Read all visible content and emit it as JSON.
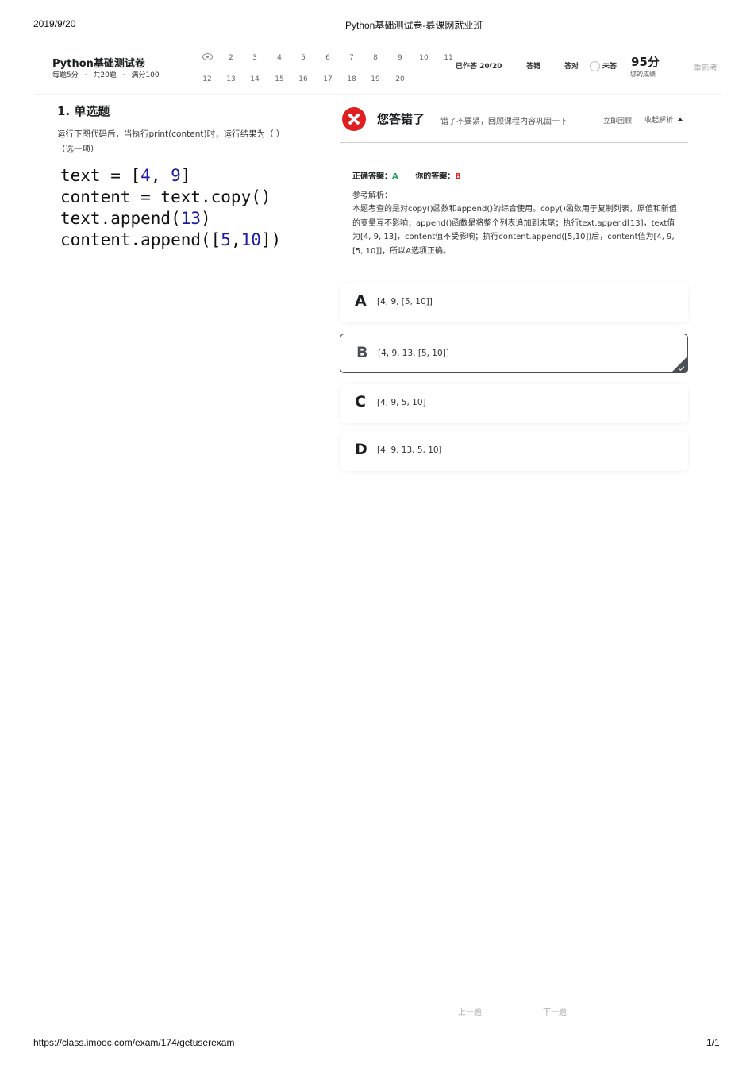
{
  "print_header": {
    "date": "2019/9/20",
    "title": "Python基础测试卷-慕课网就业班"
  },
  "print_footer": {
    "url": "https://class.imooc.com/exam/174/getuserexam",
    "page": "1/1"
  },
  "exam": {
    "title": "Python基础测试卷",
    "meta": [
      "每题5分",
      "共20题",
      "满分100"
    ],
    "meta_sep": "·"
  },
  "question_nav": {
    "row1": [
      "2",
      "3",
      "4",
      "5",
      "6",
      "7",
      "8",
      "9",
      "10",
      "11"
    ],
    "row2": [
      "12",
      "13",
      "14",
      "15",
      "16",
      "17",
      "18",
      "19",
      "20"
    ]
  },
  "stats": {
    "answered": "已作答 20/20",
    "wrong": "答错",
    "correct": "答对",
    "unanswered": "未答",
    "score": "95分",
    "score_label": "您的成绩",
    "retake": "重新考"
  },
  "question": {
    "heading": "1. 单选题",
    "text": "运行下图代码后，当执行print(content)时，运行结果为（ ）（选一项）",
    "code": [
      [
        "text = [",
        "4",
        ", ",
        "9",
        "]"
      ],
      [
        "content = text.copy()"
      ],
      [
        "text.append(",
        "13",
        ")"
      ],
      [
        "content.append([",
        "5",
        ",",
        "10",
        "])"
      ]
    ]
  },
  "result": {
    "title": "您答错了",
    "subtitle": "错了不要紧，回顾课程内容巩固一下",
    "review": "立即回顾",
    "collapse": "收起解析",
    "correct_label": "正确答案：",
    "correct_value": "A",
    "yours_label": "你的答案：",
    "yours_value": "B",
    "analysis_label": "参考解析：",
    "analysis": "本题考查的是对copy()函数和append()的综合使用。copy()函数用于复制列表，原值和新值的变量互不影响；append()函数是将整个列表追加到末尾；执行text.append[13]，text值为[4, 9, 13]，content值不受影响；执行content.append([5,10])后，content值为[4, 9, [5, 10]]，所以A选项正确。"
  },
  "options": [
    {
      "letter": "A",
      "text": "[4, 9, [5, 10]]"
    },
    {
      "letter": "B",
      "text": "[4, 9, 13, [5, 10]]"
    },
    {
      "letter": "C",
      "text": "[4, 9, 5, 10]"
    },
    {
      "letter": "D",
      "text": "[4, 9, 13, 5, 10]"
    }
  ],
  "pager": {
    "prev": "上一题",
    "next": "下一题"
  }
}
